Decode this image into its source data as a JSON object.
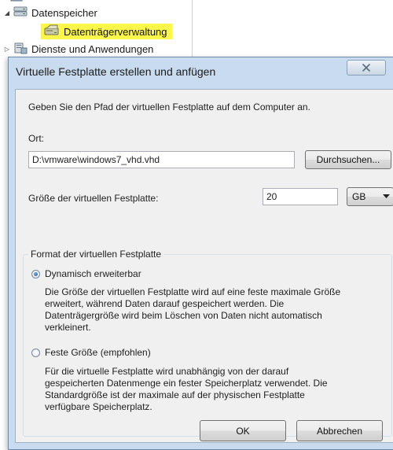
{
  "tree": {
    "items": [
      {
        "label": "Datenspeicher",
        "expander": "expanded",
        "icon": "storage-icon"
      },
      {
        "label": "Datenträgerverwaltung",
        "expander": "",
        "icon": "disk-management-icon",
        "highlighted": true,
        "highlight_color": "#fbf74a"
      },
      {
        "label": "Dienste und Anwendungen",
        "expander": "collapsed",
        "icon": "services-icon"
      }
    ]
  },
  "dialog": {
    "title": "Virtuelle Festplatte erstellen und anfügen",
    "instruction": "Geben Sie den Pfad der virtuellen Festplatte auf dem Computer an.",
    "location_label": "Ort:",
    "location_value": "D:\\vmware\\windows7_vhd.vhd",
    "browse_label": "Durchsuchen...",
    "size_label": "Größe der virtuellen Festplatte:",
    "size_value": "20",
    "unit_selected": "GB",
    "format": {
      "legend": "Format der virtuellen Festplatte",
      "options": [
        {
          "label": "Dynamisch erweiterbar",
          "checked": true,
          "description": [
            "Die Größe der virtuellen Festplatte wird auf eine feste maximale Größe",
            "erweitert, während Daten darauf gespeichert werden. Die",
            "Datenträgergröße wird beim Löschen von Daten nicht automatisch",
            "verkleinert."
          ]
        },
        {
          "label": "Feste Größe (empfohlen)",
          "checked": false,
          "description": [
            "Für die virtuelle Festplatte wird unabhängig von der darauf",
            "gespeicherten Datenmenge ein fester Speicherplatz verwendet. Die",
            "Standardgröße ist der maximale auf der physischen Festplatte",
            "verfügbare Speicherplatz."
          ]
        }
      ]
    },
    "ok_label": "OK",
    "cancel_label": "Abbrechen"
  },
  "colors": {
    "dialog_frame": "#c9dcef",
    "client_background": "#f0f0f0",
    "highlight": "#fbf74a"
  }
}
